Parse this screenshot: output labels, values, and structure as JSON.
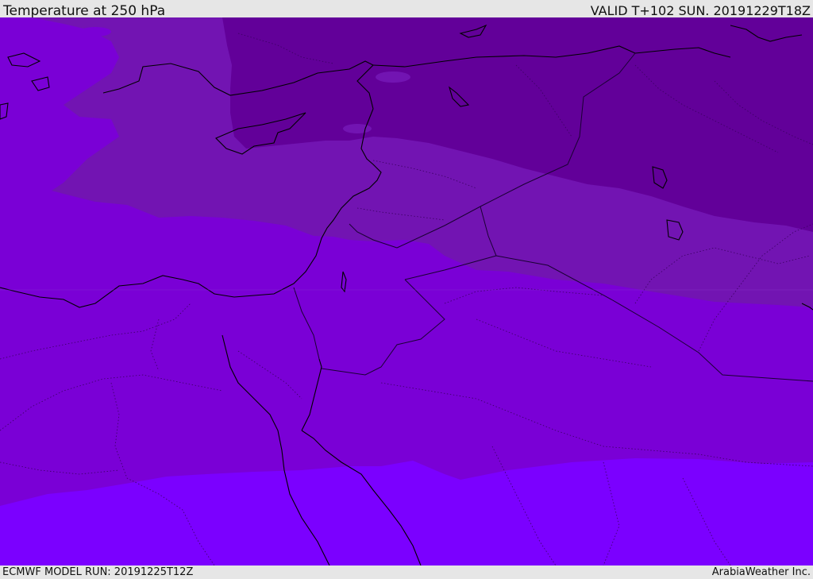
{
  "header": {
    "title": "Temperature at 250 hPa",
    "valid": "VALID T+102 SUN. 20191229T18Z"
  },
  "footer": {
    "model_run": "ECMWF MODEL RUN: 20191225T12Z",
    "credit": "ArabiaWeather Inc."
  },
  "map": {
    "field": "temperature-250hPa",
    "band_colors": {
      "darkest": "#620099",
      "dark": "#7214b2",
      "mid": "#7a00d6",
      "light": "#7b00ff"
    },
    "line_colors": {
      "coastline": "#000000",
      "border": "#1a0033"
    }
  }
}
